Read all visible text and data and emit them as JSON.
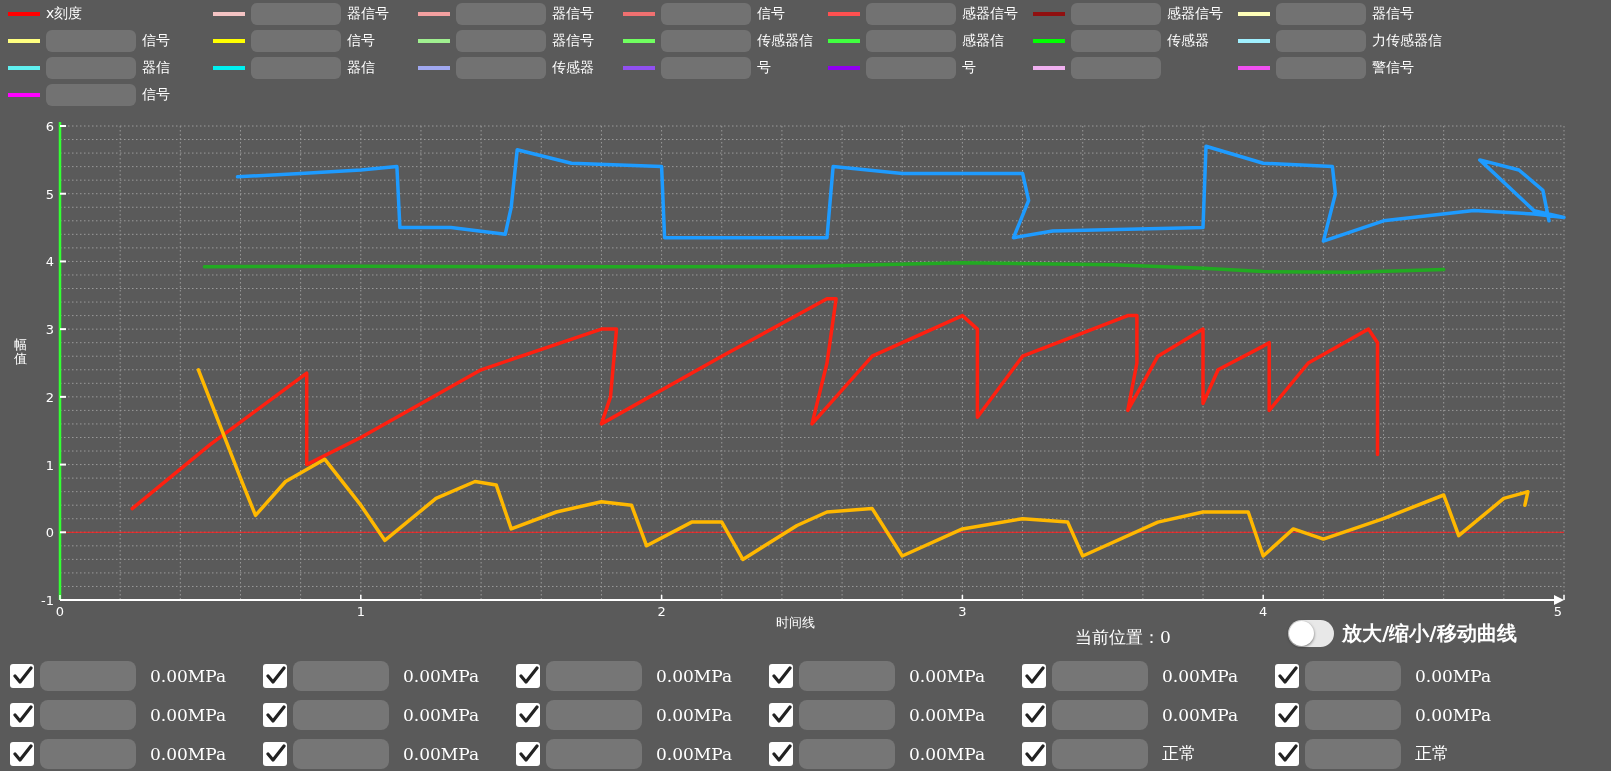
{
  "legend": [
    {
      "label": "x刻度",
      "color": "#ff0000",
      "redacted": false
    },
    {
      "label": "器信号",
      "color": "#f4c4c4",
      "redacted": true
    },
    {
      "label": "器信号",
      "color": "#f4a0a0",
      "redacted": true
    },
    {
      "label": "信号",
      "color": "#f07070",
      "redacted": true
    },
    {
      "label": "感器信号",
      "color": "#ff5050",
      "redacted": true
    },
    {
      "label": "感器信号",
      "color": "#901010",
      "redacted": true
    },
    {
      "label": "器信号",
      "color": "#ffffb8",
      "redacted": true
    },
    {
      "label": "信号",
      "color": "#ffff80",
      "redacted": true
    },
    {
      "label": "信号",
      "color": "#ffff00",
      "redacted": true
    },
    {
      "label": "器信号",
      "color": "#a0f090",
      "redacted": true
    },
    {
      "label": "传感器信",
      "color": "#70ff60",
      "redacted": true
    },
    {
      "label": "感器信",
      "color": "#40ff40",
      "redacted": true
    },
    {
      "label": "传感器",
      "color": "#00ff00",
      "redacted": true
    },
    {
      "label": "力传感器信",
      "color": "#a0f0ff",
      "redacted": true
    },
    {
      "label": "器信",
      "color": "#60f0f0",
      "redacted": true
    },
    {
      "label": "器信",
      "color": "#00f0f0",
      "redacted": true
    },
    {
      "label": "传感器",
      "color": "#a0a8f0",
      "redacted": true
    },
    {
      "label": "号",
      "color": "#9050f0",
      "redacted": true
    },
    {
      "label": "号",
      "color": "#9000f0",
      "redacted": true
    },
    {
      "color": "#f0b0f0",
      "redacted": true
    },
    {
      "label": "警信号",
      "color": "#f050f0",
      "redacted": true
    },
    {
      "label": "信号",
      "color": "#ff00ff",
      "redacted": true
    }
  ],
  "chart": {
    "chart_data": {
      "type": "line",
      "xlabel": "时间线",
      "ylabel": "幅值",
      "xlim": [
        0,
        5
      ],
      "ylim": [
        -1,
        6
      ],
      "xticks": [
        0,
        1,
        2,
        3,
        4,
        5
      ],
      "yticks": [
        -1,
        0,
        1,
        2,
        3,
        4,
        5,
        6
      ],
      "grid": true,
      "ref_lines": [
        {
          "axis": "y",
          "value": 0,
          "color": "#ff2020"
        }
      ],
      "series": [
        {
          "color": "#1e9bff",
          "x": [
            0.59,
            0.8,
            1.0,
            1.12,
            1.13,
            1.3,
            1.48,
            1.5,
            1.52,
            1.7,
            2.0,
            2.01,
            2.3,
            2.55,
            2.57,
            2.8,
            3.2,
            3.22,
            3.17,
            3.3,
            3.8,
            3.81,
            4.0,
            4.23,
            4.24,
            4.2,
            4.4,
            4.7,
            4.9,
            5.0,
            4.9,
            4.72,
            4.85,
            4.93,
            4.95
          ],
          "values": [
            5.25,
            5.3,
            5.35,
            5.4,
            4.5,
            4.5,
            4.4,
            4.8,
            5.65,
            5.45,
            5.4,
            4.35,
            4.35,
            4.35,
            5.4,
            5.3,
            5.3,
            4.9,
            4.35,
            4.45,
            4.5,
            5.7,
            5.45,
            5.4,
            5.0,
            4.3,
            4.6,
            4.75,
            4.7,
            4.65,
            4.75,
            5.5,
            5.35,
            5.05,
            4.6
          ]
        },
        {
          "color": "#22aa22",
          "x": [
            0.48,
            1.0,
            1.5,
            2.0,
            2.5,
            3.0,
            3.5,
            3.8,
            4.0,
            4.3,
            4.6
          ],
          "values": [
            3.92,
            3.93,
            3.92,
            3.92,
            3.93,
            3.98,
            3.95,
            3.9,
            3.85,
            3.84,
            3.88
          ]
        },
        {
          "color": "#ff2010",
          "x": [
            0.24,
            0.5,
            0.82,
            0.82,
            1.0,
            1.4,
            1.8,
            1.85,
            1.83,
            1.8,
            2.2,
            2.55,
            2.58,
            2.55,
            2.5,
            2.7,
            3.0,
            3.05,
            3.05,
            3.2,
            3.55,
            3.58,
            3.58,
            3.55,
            3.65,
            3.8,
            3.8,
            3.85,
            4.0,
            4.02,
            4.02,
            4.15,
            4.35,
            4.38,
            4.38
          ],
          "values": [
            0.35,
            1.3,
            2.35,
            1.0,
            1.4,
            2.4,
            3.0,
            3.0,
            2.0,
            1.6,
            2.6,
            3.45,
            3.45,
            2.5,
            1.6,
            2.6,
            3.2,
            3.0,
            1.7,
            2.6,
            3.2,
            3.2,
            2.5,
            1.8,
            2.6,
            3.0,
            1.9,
            2.4,
            2.75,
            2.8,
            1.8,
            2.5,
            3.0,
            2.8,
            1.15
          ]
        },
        {
          "color": "#ffb800",
          "x": [
            0.46,
            0.6,
            0.65,
            0.75,
            0.88,
            1.0,
            1.08,
            1.25,
            1.38,
            1.45,
            1.5,
            1.65,
            1.8,
            1.9,
            1.95,
            2.1,
            2.2,
            2.27,
            2.45,
            2.55,
            2.7,
            2.8,
            3.0,
            3.2,
            3.35,
            3.4,
            3.65,
            3.8,
            3.95,
            4.0,
            4.1,
            4.2,
            4.4,
            4.6,
            4.65,
            4.8,
            4.88,
            4.87
          ],
          "values": [
            2.4,
            0.8,
            0.25,
            0.75,
            1.08,
            0.4,
            -0.12,
            0.5,
            0.75,
            0.7,
            0.05,
            0.3,
            0.45,
            0.4,
            -0.2,
            0.15,
            0.15,
            -0.4,
            0.1,
            0.3,
            0.35,
            -0.35,
            0.05,
            0.2,
            0.15,
            -0.35,
            0.15,
            0.3,
            0.3,
            -0.35,
            0.05,
            -0.1,
            0.2,
            0.55,
            -0.05,
            0.5,
            0.6,
            0.4
          ]
        }
      ]
    }
  },
  "position": {
    "label": "当前位置：0"
  },
  "toggle": {
    "label": "放大/缩小/移动曲线",
    "on": false
  },
  "sensors": [
    {
      "checked": true,
      "value": "0.00MPa"
    },
    {
      "checked": true,
      "value": "0.00MPa"
    },
    {
      "checked": true,
      "value": "0.00MPa"
    },
    {
      "checked": true,
      "value": "0.00MPa"
    },
    {
      "checked": true,
      "value": "0.00MPa"
    },
    {
      "checked": true,
      "value": "0.00MPa"
    },
    {
      "checked": true,
      "value": "0.00MPa"
    },
    {
      "checked": true,
      "value": "0.00MPa"
    },
    {
      "checked": true,
      "value": "0.00MPa"
    },
    {
      "checked": true,
      "value": "0.00MPa"
    },
    {
      "checked": true,
      "value": "0.00MPa"
    },
    {
      "checked": true,
      "value": "0.00MPa"
    },
    {
      "checked": true,
      "value": "0.00MPa"
    },
    {
      "checked": true,
      "value": "0.00MPa"
    },
    {
      "checked": true,
      "value": "0.00MPa"
    },
    {
      "checked": true,
      "value": "0.00MPa"
    },
    {
      "checked": true,
      "value": "正常"
    },
    {
      "checked": true,
      "value": "正常"
    }
  ]
}
